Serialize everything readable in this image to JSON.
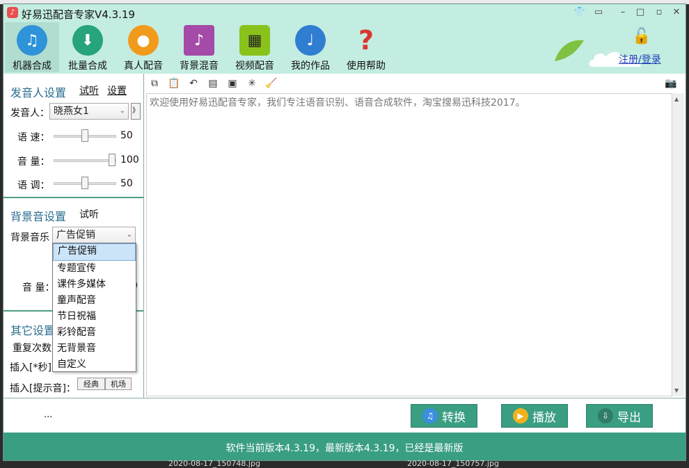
{
  "window": {
    "title": "好易迅配音专家V4.3.19",
    "app_icon": "♪"
  },
  "toolbar": [
    {
      "label": "机器合成",
      "icon": "music-note-icon",
      "color": "#2e93d8",
      "glyph": "♫"
    },
    {
      "label": "批量合成",
      "icon": "mp3-download-icon",
      "color": "#27a37d",
      "glyph": "⬇"
    },
    {
      "label": "真人配音",
      "icon": "person-icon",
      "color": "#f29a1b",
      "glyph": "●"
    },
    {
      "label": "背景混音",
      "icon": "equalizer-icon",
      "color": "#a44aa8",
      "glyph": "♪"
    },
    {
      "label": "视频配音",
      "icon": "film-icon",
      "color": "#88c21a",
      "glyph": "▦"
    },
    {
      "label": "我的作品",
      "icon": "music-note-blue-icon",
      "color": "#2f7ed2",
      "glyph": "♩"
    },
    {
      "label": "使用帮助",
      "icon": "question-mark-icon",
      "color": "#d9372f",
      "glyph": "?"
    }
  ],
  "account": {
    "login_label": "注册/登录"
  },
  "voice_settings": {
    "title": "发音人设置",
    "listen_label": "试听",
    "settings_label": "设置",
    "speaker_label": "发音人：",
    "speaker_value": "晓燕女1",
    "speed_label": "语 速：",
    "speed_value": "50",
    "speed_fraction": 0.5,
    "volume_label": "音 量：",
    "volume_value": "100",
    "volume_fraction": 1.0,
    "pitch_label": "语 调：",
    "pitch_value": "50",
    "pitch_fraction": 0.5
  },
  "bg_settings": {
    "title": "背景音设置",
    "listen_label": "试听",
    "music_label": "背景音乐",
    "music_value": "广告促销",
    "volume_label": "音 量：",
    "volume_tail": "0",
    "options": [
      "广告促销",
      "专题宣传",
      "课件多媒体",
      "童声配音",
      "节日祝福",
      "彩铃配音",
      "无背景音",
      "自定义"
    ],
    "selected_index": 0
  },
  "other_settings": {
    "title": "其它设置",
    "repeat_label": "重复次数",
    "insert_sec_label": "插入[*秒]",
    "insert_tone_label": "插入[提示音]：",
    "tone_buttons": [
      "经典",
      "机场"
    ]
  },
  "editor": {
    "tools": [
      "copy-icon",
      "paste-icon",
      "undo-icon",
      "document-icon",
      "save-icon",
      "clear-icon",
      "broom-icon"
    ],
    "text": "欢迎使用好易迅配音专家，我们专注语音识别、语音合成软件，淘宝搜易迅科技2017。"
  },
  "actions": {
    "ellipsis": "...",
    "convert_label": "转换",
    "play_label": "播放",
    "export_label": "导出"
  },
  "status": {
    "text": "软件当前版本4.3.19，最新版本4.3.19，已经是最新版"
  },
  "background": {
    "files": [
      "2020-08-17_150748.jpg",
      "2020-08-17_150757.jpg"
    ]
  }
}
